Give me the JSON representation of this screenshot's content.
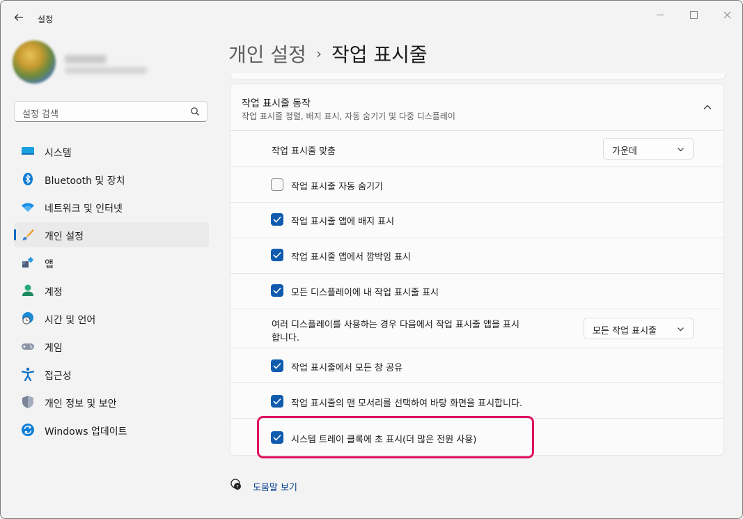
{
  "window": {
    "title": "설정"
  },
  "search": {
    "placeholder": "설정 검색"
  },
  "nav": {
    "items": [
      {
        "label": "시스템",
        "icon": "system-icon"
      },
      {
        "label": "Bluetooth 및 장치",
        "icon": "bluetooth-icon"
      },
      {
        "label": "네트워크 및 인터넷",
        "icon": "wifi-icon"
      },
      {
        "label": "개인 설정",
        "icon": "brush-icon",
        "active": true
      },
      {
        "label": "앱",
        "icon": "apps-icon"
      },
      {
        "label": "계정",
        "icon": "account-icon"
      },
      {
        "label": "시간 및 언어",
        "icon": "globe-clock-icon"
      },
      {
        "label": "게임",
        "icon": "gamepad-icon"
      },
      {
        "label": "접근성",
        "icon": "accessibility-icon"
      },
      {
        "label": "개인 정보 및 보안",
        "icon": "shield-icon"
      },
      {
        "label": "Windows 업데이트",
        "icon": "update-icon"
      }
    ]
  },
  "header": {
    "crumb_parent": "개인 설정",
    "separator": "›",
    "crumb_current": "작업 표시줄"
  },
  "section": {
    "title": "작업 표시줄 동작",
    "subtitle": "작업 표시줄 정렬, 배지 표시, 자동 숨기기 및 다중 디스플레이"
  },
  "settings": {
    "alignment_label": "작업 표시줄 맞춤",
    "alignment_value": "가운데",
    "auto_hide": "작업 표시줄 자동 숨기기",
    "badges": "작업 표시줄 앱에 배지 표시",
    "flashing": "작업 표시줄 앱에서 깜박임 표시",
    "all_displays": "모든 디스플레이에 내 작업 표시줄 표시",
    "multi_display_line1": "여러 디스플레이를 사용하는 경우 다음에서 작업 표시줄 앱을 표시",
    "multi_display_line2": "합니다.",
    "multi_display_value": "모든 작업 표시줄",
    "share_windows": "작업 표시줄에서 모든 창 공유",
    "far_corner": "작업 표시줄의 맨 모서리를 선택하여 바탕 화면을 표시합니다.",
    "seconds": "시스템 트레이 클록에 초 표시(더 많은 전원 사용)"
  },
  "checkbox_state": {
    "auto_hide": false,
    "badges": true,
    "flashing": true,
    "all_displays": true,
    "share_windows": true,
    "far_corner": true,
    "seconds": true
  },
  "help": {
    "label": "도움말 보기"
  },
  "colors": {
    "accent": "#0f5cae",
    "highlight": "#e0115f",
    "link": "#003e92"
  }
}
